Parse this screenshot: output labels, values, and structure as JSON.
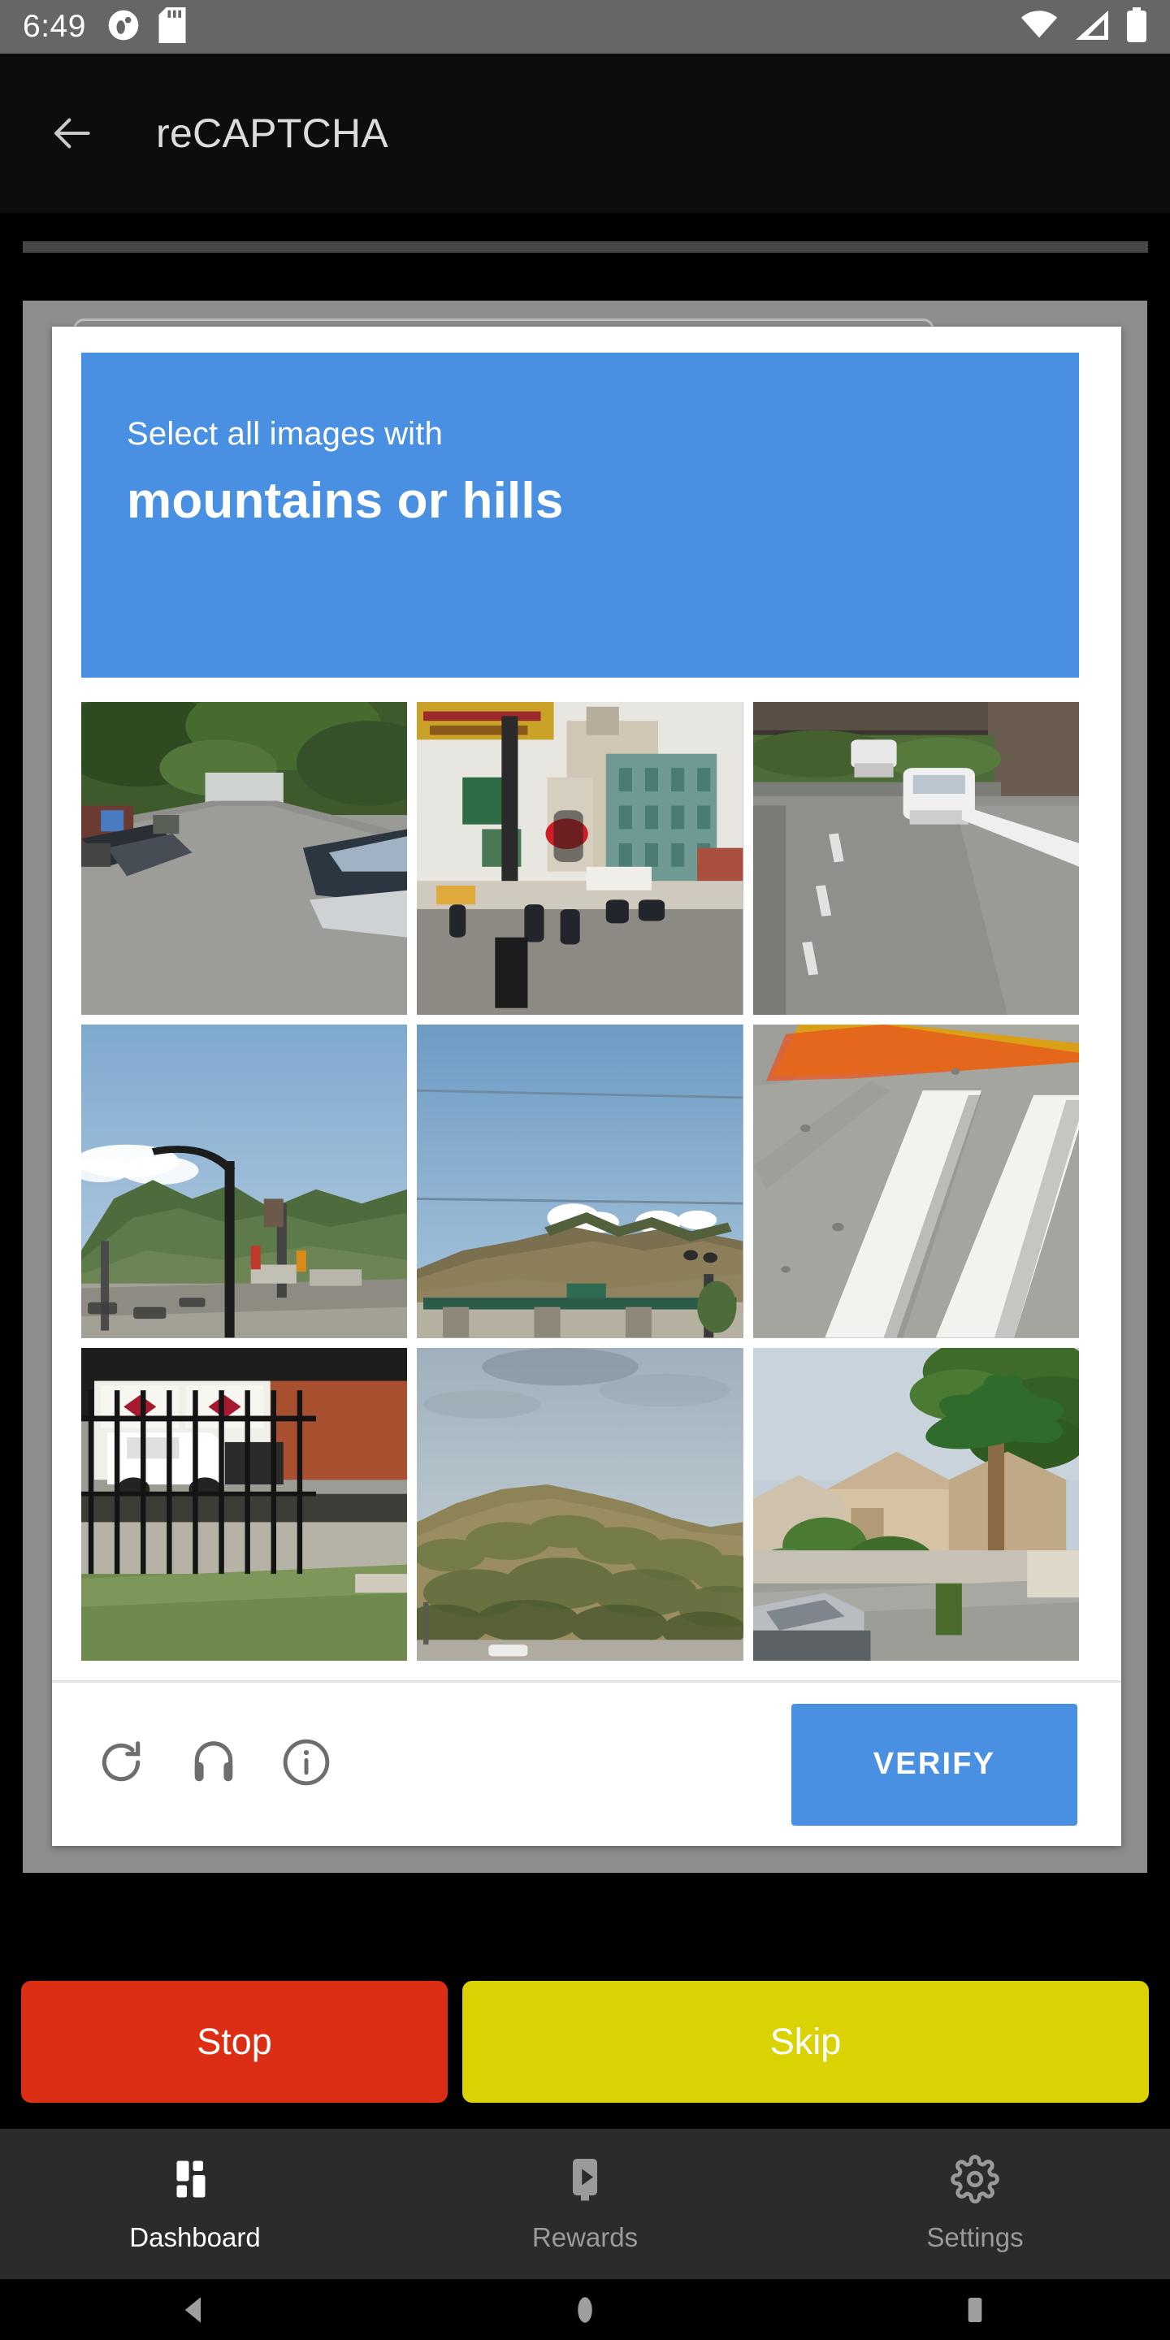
{
  "status_bar": {
    "time": "6:49",
    "background": "#666666",
    "left_icons": [
      "app-notification-icon",
      "sd-card-icon"
    ],
    "right_icons": [
      "wifi-icon",
      "cellular-signal-icon",
      "battery-icon"
    ]
  },
  "header": {
    "back_icon": "back-arrow-icon",
    "title": "reCAPTCHA",
    "background": "#0d0d0d"
  },
  "captcha": {
    "prompt_prefix": "Select all images with",
    "prompt_target": "mountains or hills",
    "banner_color": "#4a90e2",
    "tiles": [
      {
        "index": 1,
        "description": "tree-lined residential street with parked cars",
        "selected": false
      },
      {
        "index": 2,
        "description": "city street with red traffic light and storefronts",
        "selected": false
      },
      {
        "index": 3,
        "description": "highway under an overpass with white cars",
        "selected": false
      },
      {
        "index": 4,
        "description": "mountain range behind street lamp and parking lot",
        "selected": false
      },
      {
        "index": 5,
        "description": "mountain ridge above a green highway sign gantry",
        "selected": false
      },
      {
        "index": 6,
        "description": "crosswalk stripes and yellow road lines on pavement",
        "selected": false
      },
      {
        "index": 7,
        "description": "white delivery trucks behind an iron fence",
        "selected": false
      },
      {
        "index": 8,
        "description": "dry brush-covered hillside under hazy sky",
        "selected": false
      },
      {
        "index": 9,
        "description": "suburban house with palm tree and parked car",
        "selected": false
      }
    ],
    "footer": {
      "reload_icon": "reload-icon",
      "audio_icon": "headphones-icon",
      "info_icon": "info-icon",
      "verify_label": "VERIFY",
      "verify_color": "#4a90e2"
    }
  },
  "actions": {
    "stop_label": "Stop",
    "stop_color": "#dc2d15",
    "skip_label": "Skip",
    "skip_color": "#dbd203"
  },
  "bottom_nav": {
    "items": [
      {
        "label": "Dashboard",
        "icon": "dashboard-icon",
        "active": true
      },
      {
        "label": "Rewards",
        "icon": "smart-display-icon",
        "active": false
      },
      {
        "label": "Settings",
        "icon": "gear-icon",
        "active": false
      }
    ]
  },
  "system_nav": {
    "back": "system-back-icon",
    "home": "system-home-icon",
    "recents": "system-recents-icon"
  }
}
